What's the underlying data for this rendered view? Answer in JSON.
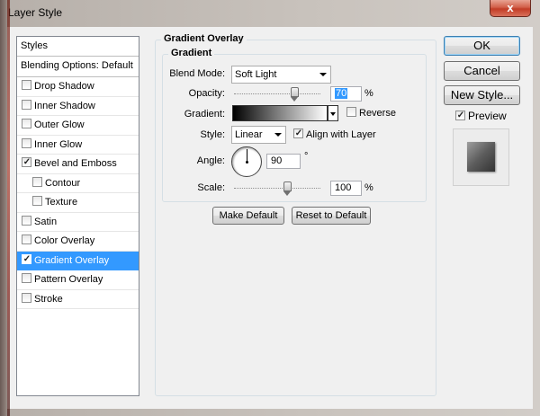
{
  "window": {
    "title": "Layer Style",
    "close_glyph": "x"
  },
  "styles_list": {
    "header": "Styles",
    "blending": "Blending Options: Default",
    "items": [
      {
        "label": "Drop Shadow",
        "checked": false,
        "sub": false,
        "selected": false
      },
      {
        "label": "Inner Shadow",
        "checked": false,
        "sub": false,
        "selected": false
      },
      {
        "label": "Outer Glow",
        "checked": false,
        "sub": false,
        "selected": false
      },
      {
        "label": "Inner Glow",
        "checked": false,
        "sub": false,
        "selected": false
      },
      {
        "label": "Bevel and Emboss",
        "checked": true,
        "sub": false,
        "selected": false
      },
      {
        "label": "Contour",
        "checked": false,
        "sub": true,
        "selected": false
      },
      {
        "label": "Texture",
        "checked": false,
        "sub": true,
        "selected": false
      },
      {
        "label": "Satin",
        "checked": false,
        "sub": false,
        "selected": false
      },
      {
        "label": "Color Overlay",
        "checked": false,
        "sub": false,
        "selected": false
      },
      {
        "label": "Gradient Overlay",
        "checked": true,
        "sub": false,
        "selected": true
      },
      {
        "label": "Pattern Overlay",
        "checked": false,
        "sub": false,
        "selected": false
      },
      {
        "label": "Stroke",
        "checked": false,
        "sub": false,
        "selected": false
      }
    ]
  },
  "panel": {
    "group_title": "Gradient Overlay",
    "subgroup_title": "Gradient",
    "blend_mode": {
      "label": "Blend Mode:",
      "value": "Soft Light"
    },
    "opacity": {
      "label": "Opacity:",
      "value": "70",
      "unit": "%",
      "level_percent": 70
    },
    "gradient": {
      "label": "Gradient:",
      "reverse_label": "Reverse",
      "reverse_checked": false
    },
    "style": {
      "label": "Style:",
      "value": "Linear",
      "align_label": "Align with Layer",
      "align_checked": true
    },
    "angle": {
      "label": "Angle:",
      "value": "90",
      "unit": "°"
    },
    "scale": {
      "label": "Scale:",
      "value": "100",
      "unit": "%",
      "level_percent": 100
    },
    "make_default": "Make Default",
    "reset_default": "Reset to Default"
  },
  "actions": {
    "ok": "OK",
    "cancel": "Cancel",
    "new_style": "New Style...",
    "preview_label": "Preview",
    "preview_checked": true
  },
  "colors": {
    "selection": "#3399ff",
    "close_button": "#c23c26"
  }
}
